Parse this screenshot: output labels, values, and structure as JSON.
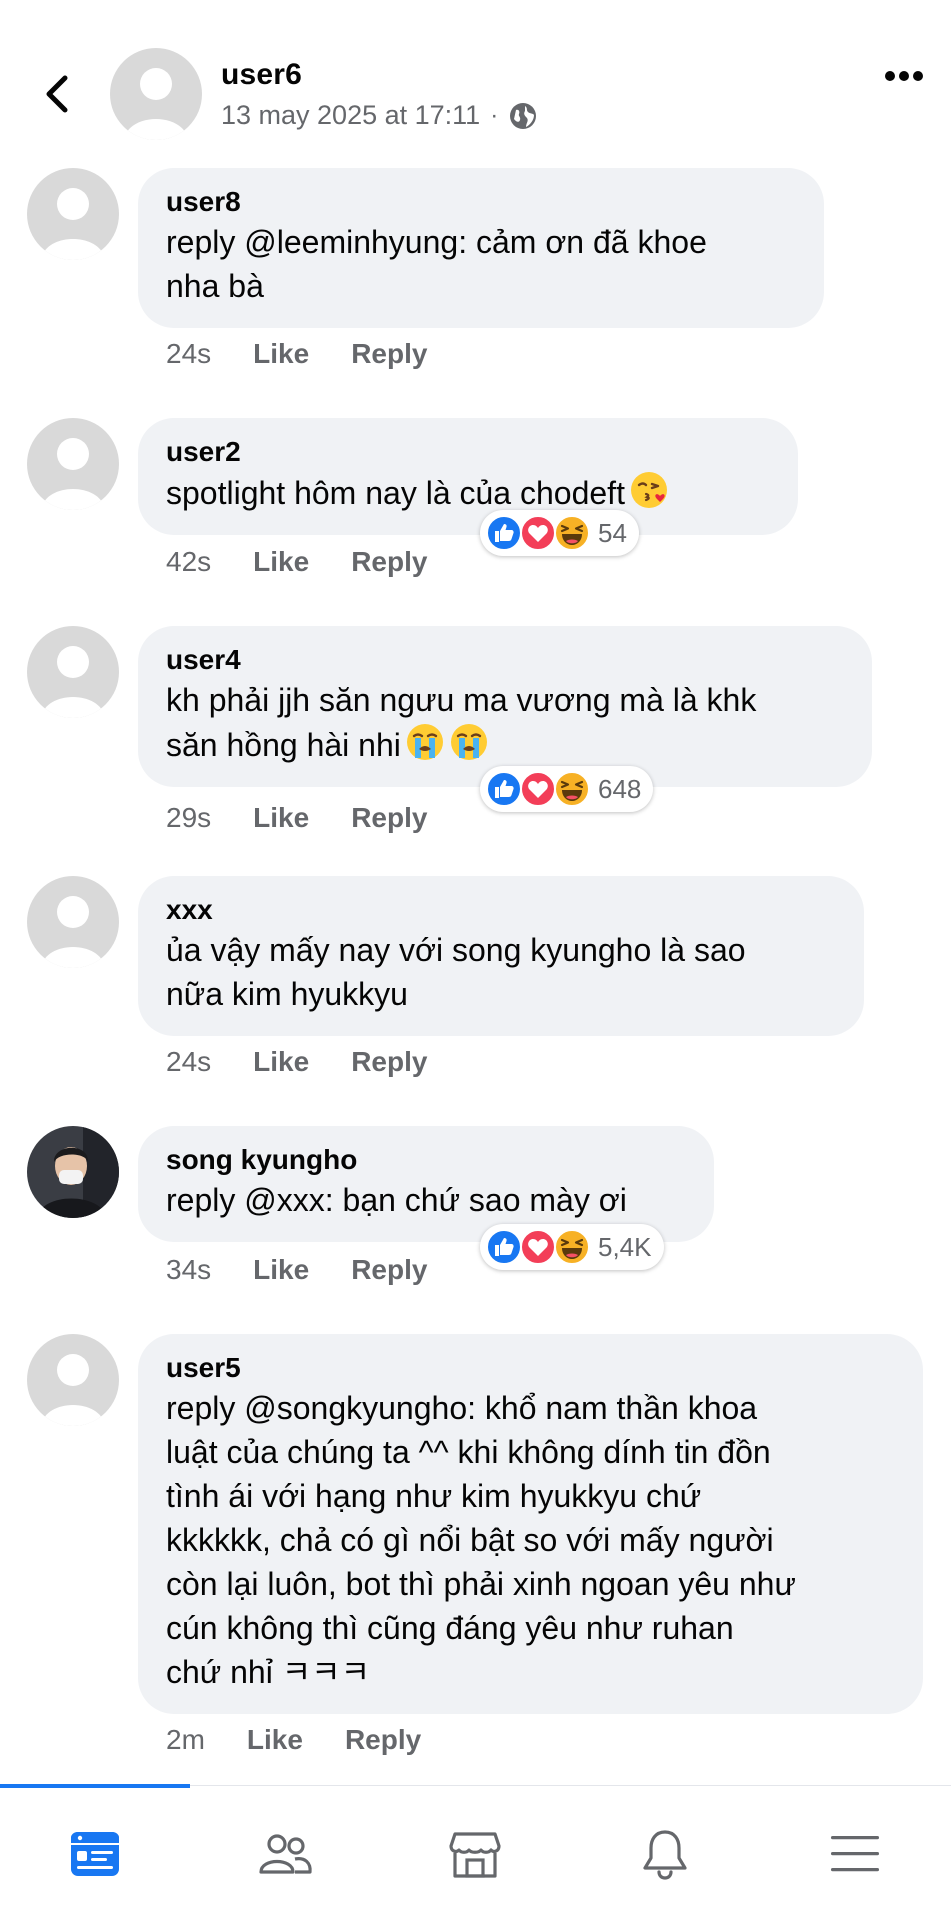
{
  "header": {
    "author": "user6",
    "timestamp": "13 may 2025 at 17:11",
    "separator": "·",
    "privacy_icon": "globe-icon"
  },
  "comments": [
    {
      "name": "user8",
      "text": "reply @leeminhyung: cảm ơn đã khoe\nnha bà",
      "time": "24s",
      "like": "Like",
      "reply": "Reply"
    },
    {
      "name": "user2",
      "text": "spotlight hôm nay là của chodeft",
      "emoji": "kissing-face-emoji",
      "time": "42s",
      "like": "Like",
      "reply": "Reply",
      "reactions": "54"
    },
    {
      "name": "user4",
      "text": "kh phải jjh săn ngưu ma vương mà là khk\nsăn hồng hài nhi",
      "emoji": "crying-face-emoji",
      "time": "29s",
      "like": "Like",
      "reply": "Reply",
      "reactions": "648"
    },
    {
      "name": "xxx",
      "text": "ủa vậy mấy nay với song kyungho là sao\nnữa kim hyukkyu",
      "time": "24s",
      "like": "Like",
      "reply": "Reply"
    },
    {
      "name": "song kyungho",
      "text": "reply @xxx: bạn chứ sao mày ơi",
      "time": "34s",
      "like": "Like",
      "reply": "Reply",
      "reactions": "5,4K"
    },
    {
      "name": "user5",
      "text": "reply @songkyungho: khổ nam thần khoa\nluật của chúng ta ^^ khi không dính tin đồn\ntình ái với hạng như kim hyukkyu chứ\nkkkkkk, chả có gì nổi bật so với mấy người\ncòn lại luôn, bot thì phải xinh ngoan yêu như\ncún không thì cũng đáng yêu như ruhan\nchứ nhỉ ㅋㅋㅋ",
      "time": "2m",
      "like": "Like",
      "reply": "Reply"
    }
  ],
  "bottom_nav": {
    "items": [
      "feed-icon",
      "friends-icon",
      "marketplace-icon",
      "notifications-icon",
      "menu-icon"
    ],
    "active": "feed-icon"
  },
  "colors": {
    "accent": "#1877f2",
    "bubble": "#f0f2f5",
    "secondary_text": "#65676b",
    "love": "#f33e58",
    "haha": "#f7b125"
  }
}
